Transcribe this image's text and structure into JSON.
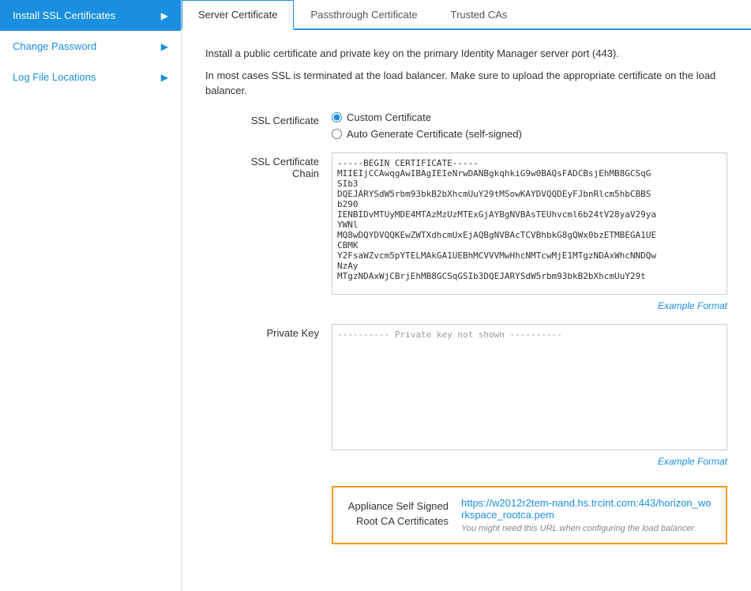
{
  "sidebar": {
    "items": [
      {
        "id": "install-ssl",
        "label": "Install SSL Certificates",
        "active": true,
        "hasChevron": true
      },
      {
        "id": "change-password",
        "label": "Change Password",
        "active": false,
        "hasChevron": true
      },
      {
        "id": "log-file",
        "label": "Log File Locations",
        "active": false,
        "hasChevron": true
      }
    ]
  },
  "tabs": [
    {
      "id": "server-cert",
      "label": "Server Certificate",
      "active": true
    },
    {
      "id": "passthrough-cert",
      "label": "Passthrough Certificate",
      "active": false
    },
    {
      "id": "trusted-cas",
      "label": "Trusted CAs",
      "active": false
    }
  ],
  "content": {
    "intro1": "Install a public certificate and private key on the primary Identity Manager server port (443).",
    "intro2": "In most cases SSL is terminated at the load balancer. Make sure to upload the appropriate certificate on the load balancer.",
    "ssl_certificate_label": "SSL Certificate",
    "radio_custom": "Custom Certificate",
    "radio_auto": "Auto Generate Certificate (self-signed)",
    "ssl_chain_label": "SSL Certificate Chain",
    "ssl_chain_value": "-----BEGIN CERTIFICATE-----\nMIIEIjCCAwqgAwIBAgIEIeNrwDANBgkqhkiG9w0BAQsFADCBsjEhMB8GCSqG\nSIb3\nDQEJARYSdW5rbm93bkB2bXhcmUuY29tMSowKAYDVQQDEyFJbnRlcm5hbCBBS\nb290\nIENBIDvMTUyMDE4MTAzMzUzMTExGjAYBgNVBAsTEUhvcml6b24tV28yaV29ya\nYWNl\nMQ8wDQYDVQQKEwZWTXdhcmUxEjAQBgNVBAcTCVBhbkG8gQWx0bzETMBEGA1UE\nCBMK\nY2FsaWZvcm5pYTELMAkGA1UEBhMCVVVMwHhcNMTcwMjE1MTgzNDAxWhcNNDQw\nNzAy\nMTgzNDAxWjCBrjEhMB8GCSqGSIb3DQEJARYSdW5rbm93bkB2bXhcmUuY29t",
    "example_format_1": "Example Format",
    "private_key_label": "Private Key",
    "private_key_value": "---------- Private key not shown ----------",
    "example_format_2": "Example Format",
    "appliance_label": "Appliance Self Signed Root CA Certificates",
    "appliance_url": "https://w2012r2tem-nand.hs.trcint.com:443/horizon_workspace_rootca.pem",
    "appliance_hint": "You might need this URL when configuring the load balancer."
  }
}
